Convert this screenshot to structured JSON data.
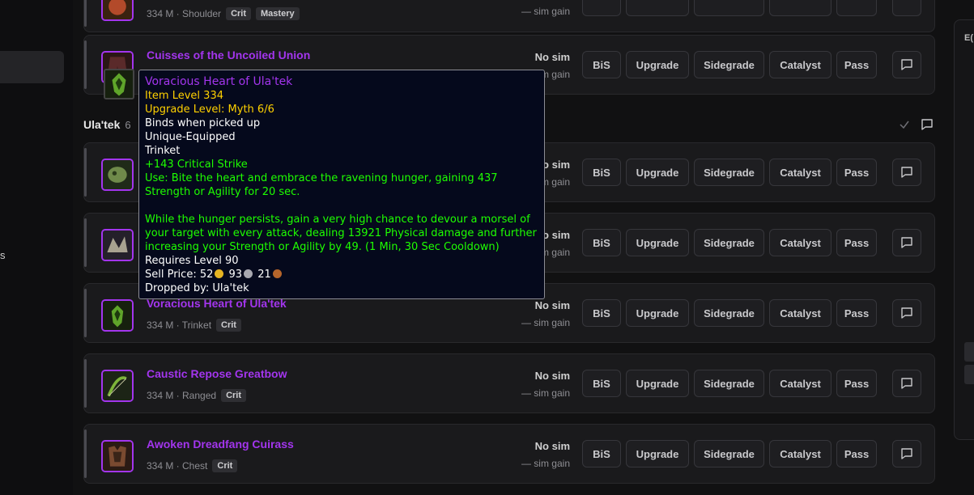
{
  "colors": {
    "epic": "#a335ee",
    "yellow": "#ffd100",
    "green": "#1eff00"
  },
  "sidebar": {
    "fragment_text": "s"
  },
  "right_panel": {
    "label": "E("
  },
  "group": {
    "name": "Ula'tek",
    "count": "6"
  },
  "rows": [
    {
      "name": "",
      "slot_meta": "334 M · Shoulder",
      "chips": [
        "Crit",
        "Mastery"
      ],
      "status": "",
      "gain": "— sim gain"
    },
    {
      "name": "Cuisses of the Uncoiled Union",
      "slot_meta": "",
      "chips": [],
      "status": "No sim",
      "gain": "— sim gain"
    },
    {
      "name": "",
      "slot_meta": "",
      "chips": [],
      "status": "No sim",
      "gain": "— sim gain"
    },
    {
      "name": "",
      "slot_meta": "",
      "chips": [],
      "status": "No sim",
      "gain": "— sim gain"
    },
    {
      "name": "Voracious Heart of Ula'tek",
      "slot_meta": "334 M · Trinket",
      "chips": [
        "Crit"
      ],
      "status": "No sim",
      "gain": "— sim gain"
    },
    {
      "name": "Caustic Repose Greatbow",
      "slot_meta": "334 M · Ranged",
      "chips": [
        "Crit"
      ],
      "status": "No sim",
      "gain": "— sim gain"
    },
    {
      "name": "Awoken Dreadfang Cuirass",
      "slot_meta": "334 M · Chest",
      "chips": [
        "Crit"
      ],
      "status": "No sim",
      "gain": "— sim gain"
    }
  ],
  "buttons": {
    "bis": "BiS",
    "upgrade": "Upgrade",
    "sidegrade": "Sidegrade",
    "catalyst": "Catalyst",
    "pass": "Pass"
  },
  "tooltip": {
    "name": "Voracious Heart of Ula'tek",
    "item_level": "Item Level 334",
    "upgrade_level": "Upgrade Level: Myth 6/6",
    "binds": "Binds when picked up",
    "unique": "Unique-Equipped",
    "type": "Trinket",
    "stat": "+143 Critical Strike",
    "use": "Use: Bite the heart and embrace the ravening hunger, gaining 437 Strength or Agility for 20 sec.",
    "effect": "While the hunger persists, gain a very high chance to devour a morsel of your target with every attack, dealing 13921 Physical damage and further increasing your Strength or Agility by 49. (1 Min, 30 Sec Cooldown)",
    "requires": "Requires Level 90",
    "sell_label": "Sell Price:",
    "sell_gold": "52",
    "sell_silver": "93",
    "sell_copper": "21",
    "dropped_by": "Dropped by: Ula'tek"
  }
}
